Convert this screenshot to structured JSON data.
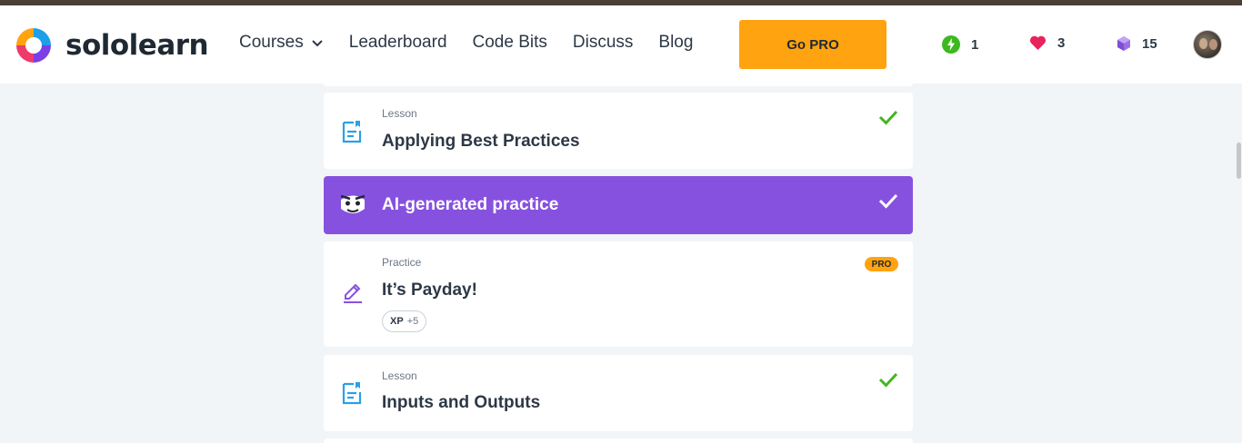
{
  "app": {
    "brand": "sololearn"
  },
  "nav": {
    "items": [
      "Courses",
      "Leaderboard",
      "Code Bits",
      "Discuss",
      "Blog"
    ],
    "go_pro": "Go PRO"
  },
  "stats": {
    "streak": "1",
    "hearts": "3",
    "bits": "15"
  },
  "colors": {
    "accent": "#ffa310",
    "ai": "#8751e0",
    "check": "#44b520",
    "lesson_icon": "#2aa0e8"
  },
  "cards": [
    {
      "kind": "lesson",
      "type": "Lesson",
      "title": "Applying Best Practices",
      "completed": true,
      "icon": "lesson-doc-icon"
    },
    {
      "kind": "ai",
      "title": "AI-generated practice",
      "completed": true,
      "icon": "ai-bot-icon"
    },
    {
      "kind": "practice",
      "type": "Practice",
      "title": "It’s Payday!",
      "badge": "PRO",
      "xp_label": "XP",
      "xp_value": "+5",
      "icon": "pencil-icon"
    },
    {
      "kind": "lesson",
      "type": "Lesson",
      "title": "Inputs and Outputs",
      "completed": true,
      "icon": "lesson-doc-icon"
    }
  ]
}
